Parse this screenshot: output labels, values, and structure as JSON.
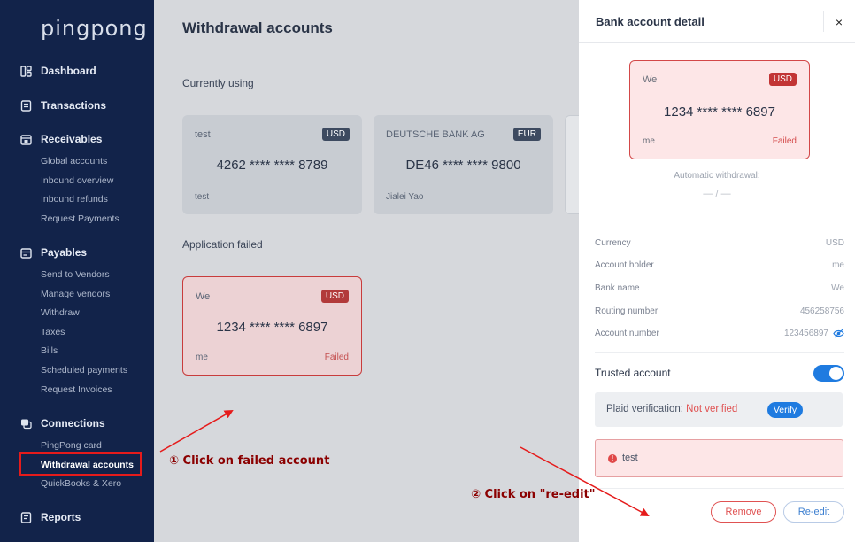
{
  "sidebar": {
    "logo": "pingpong",
    "sections": [
      {
        "label": "Dashboard",
        "icon": "dashboard-icon",
        "items": []
      },
      {
        "label": "Transactions",
        "icon": "transactions-icon",
        "items": []
      },
      {
        "label": "Receivables",
        "icon": "receivables-icon",
        "items": [
          "Global accounts",
          "Inbound overview",
          "Inbound refunds",
          "Request Payments"
        ]
      },
      {
        "label": "Payables",
        "icon": "payables-icon",
        "items": [
          "Send to Vendors",
          "Manage vendors",
          "Withdraw",
          "Taxes",
          "Bills",
          "Scheduled payments",
          "Request Invoices"
        ]
      },
      {
        "label": "Connections",
        "icon": "connections-icon",
        "items": [
          "PingPong card",
          "Withdrawal accounts",
          "QuickBooks & Xero"
        ]
      },
      {
        "label": "Reports",
        "icon": "reports-icon",
        "items": []
      }
    ],
    "active_item": "Withdrawal accounts"
  },
  "main": {
    "title": "Withdrawal accounts",
    "currently_using_title": "Currently using",
    "currently_using": [
      {
        "name": "test",
        "currency": "USD",
        "number": "4262 **** **** 8789",
        "holder": "test"
      },
      {
        "name": "DEUTSCHE BANK AG",
        "currency": "EUR",
        "number": "DE46 **** **** 9800",
        "holder": "Jialei Yao"
      }
    ],
    "failed_title": "Application failed",
    "failed": [
      {
        "name": "We",
        "currency": "USD",
        "number": "1234 **** **** 6897",
        "holder": "me",
        "status": "Failed"
      }
    ]
  },
  "annotations": {
    "step1": "① Click on failed account",
    "step2": "② Click on \"re-edit\"",
    "color": "#e51b1b"
  },
  "drawer": {
    "title": "Bank account detail",
    "close": "×",
    "card": {
      "name": "We",
      "currency": "USD",
      "number": "1234 **** **** 6897",
      "holder": "me",
      "status": "Failed"
    },
    "auto_withdrawal_label": "Automatic withdrawal:",
    "auto_withdrawal_value": "— / —",
    "details": {
      "currency": {
        "label": "Currency",
        "value": "USD"
      },
      "holder": {
        "label": "Account holder",
        "value": "me"
      },
      "bank": {
        "label": "Bank name",
        "value": "We"
      },
      "routing": {
        "label": "Routing number",
        "value": "456258756"
      },
      "account": {
        "label": "Account number",
        "value": "123456897"
      }
    },
    "trusted_label": "Trusted account",
    "trusted_on": true,
    "plaid_label": "Plaid verification:",
    "plaid_status": "Not verified",
    "verify_label": "Verify",
    "error_text": "test",
    "remove_label": "Remove",
    "reedit_label": "Re-edit"
  },
  "colors": {
    "sidebar_bg": "#12234a",
    "accent": "#1f7be0",
    "danger": "#e05252"
  }
}
